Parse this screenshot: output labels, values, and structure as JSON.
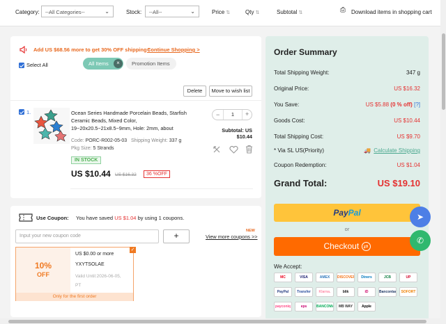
{
  "filters": {
    "category_label": "Category:",
    "category_value": "--All Categories--",
    "stock_label": "Stock:",
    "stock_value": "--All--",
    "price_label": "Price",
    "qty_label": "Qty",
    "subtotal_label": "Subtotal",
    "download_label": "Download items in shopping cart"
  },
  "promo": {
    "text": "Add US $68.56 more to get 30% OFF shipping !",
    "link": "Continue Shopping >"
  },
  "cart": {
    "select_all": "Select All",
    "tab_all": "All Items",
    "tab_promo": "Promotion Items",
    "delete": "Delete",
    "move_wishlist": "Move to wish list"
  },
  "item": {
    "index": "1.",
    "title_lines": [
      "Ocean Series Handmade Porcelain Beads, Starfish",
      "Ceramic Beads, Mixed Color,",
      "19~20x20.5~21x8.5~9mm, Hole: 2mm, about"
    ],
    "code_label": "Code:",
    "code": "PORC-R002-05-03",
    "weight_label": "Shipping Weight:",
    "weight": "337 g",
    "pkg_label": "Pkg Size:",
    "pkg": "5 Strands",
    "stock": "IN STOCK",
    "price": "US $10.44",
    "old_price": "US $16.32",
    "discount": "36 %OFF",
    "qty": "1",
    "subtotal_label": "Subtotal: US",
    "subtotal_value": "$10.44",
    "colors": {
      "accent": "#e53030",
      "stock_green": "#4caf50"
    }
  },
  "coupon": {
    "label": "Use Coupon:",
    "saved_pre": "You have saved",
    "saved_amt": "US $1.04",
    "saved_post": "by using 1 coupons.",
    "input_placeholder": "Input your new coupon code",
    "plus": "+",
    "new_badge": "NEW",
    "more_link": "View more coupons >>",
    "card_pct": "10%",
    "card_off": "OFF",
    "card_min": "US $0.00 or more",
    "card_code": "YXYTSOLAE",
    "card_valid": [
      "Valid Until:2026-06-05,",
      "PT"
    ],
    "card_footer": "Only for the first order"
  },
  "summary": {
    "title": "Order Summary",
    "rows": [
      {
        "label": "Total Shipping Weight:",
        "value": "347  g"
      },
      {
        "label": "Original Price:",
        "value": "US $16.32"
      },
      {
        "label": "You Save:",
        "value": "US $5.88",
        "pct": "(0 % off)",
        "help": "[?]"
      },
      {
        "label": "Goods Cost:",
        "value": "US $10.44"
      },
      {
        "label": "Total Shipping Cost:",
        "value": "US $9.70"
      },
      {
        "label": "* Via SL US(Priority)",
        "value": "Calculate Shipping"
      },
      {
        "label": "Coupon Redemption:",
        "value": "US $1.04"
      }
    ],
    "grand_label": "Grand Total:",
    "grand_value": "US $19.10",
    "paypal_a": "Pay",
    "paypal_b": "Pal",
    "or": "or",
    "checkout": "Checkout",
    "we_accept": "We Accept:",
    "payments": [
      "MC",
      "VISA",
      "AMEX",
      "DISCOVER",
      "Diners",
      "JCB",
      "UP",
      "PayPal",
      "Transfer",
      "Klarna.",
      "blik",
      "iD",
      "Bancontact",
      "SOFORT",
      "payconiq",
      "eps",
      "BANCOMAT Pay",
      "MB WAY",
      "Apple Pay"
    ]
  }
}
